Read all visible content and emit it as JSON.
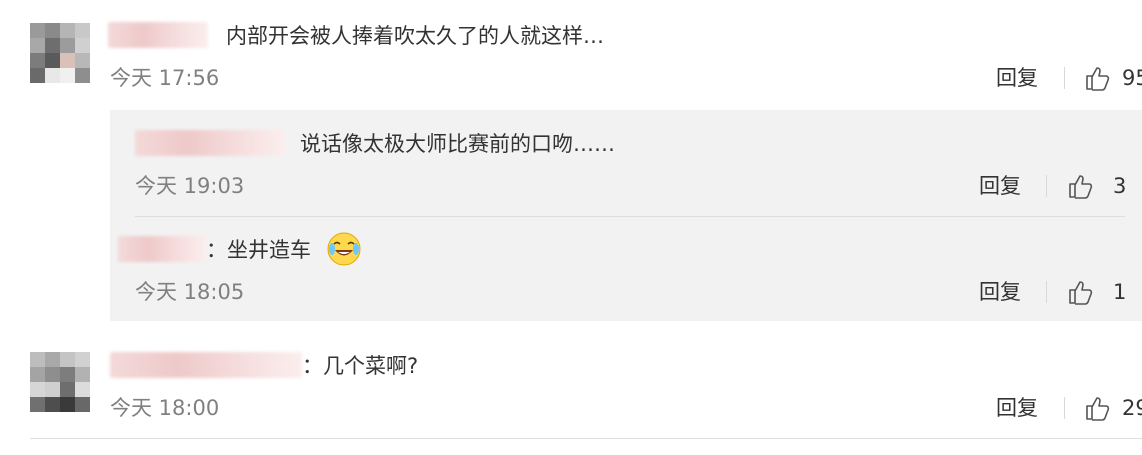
{
  "comments": [
    {
      "text": "内部开会被人捧着吹太久了的人就这样…",
      "time": "今天 17:56",
      "reply_label": "回复",
      "likes": "95"
    },
    {
      "text": "：几个菜啊?",
      "time": "今天 18:00",
      "reply_label": "回复",
      "likes": "29"
    }
  ],
  "replies": [
    {
      "text": "说话像太极大师比赛前的口吻……",
      "time": "今天 19:03",
      "reply_label": "回复",
      "likes": "3"
    },
    {
      "text": "：坐井造车",
      "time": "今天 18:05",
      "reply_label": "回复",
      "likes": "1",
      "emoji": "crying-laughing-face"
    }
  ],
  "colors": {
    "text": "#333333",
    "time": "#808080",
    "reply_background": "#f2f2f2",
    "divider": "#dedede",
    "username_accent": "#eb7350"
  }
}
